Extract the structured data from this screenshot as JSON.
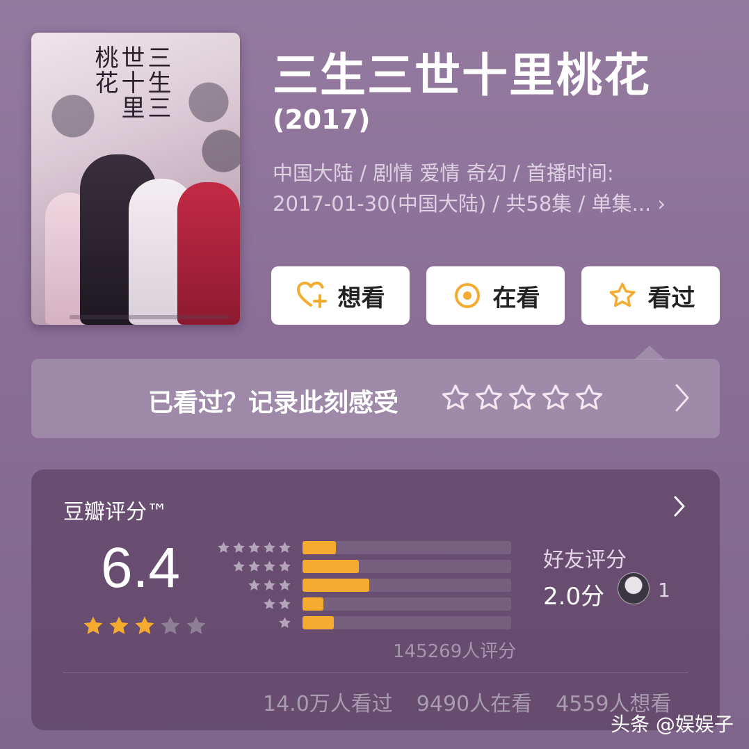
{
  "header": {
    "title": "三生三世十里桃花",
    "year": "(2017)",
    "meta_line1": "中国大陆 / 剧情 爱情 奇幻 / 首播时间:",
    "meta_line2": "2017-01-30(中国大陆) / 共58集 / 单集...",
    "meta_more": "›"
  },
  "poster": {
    "calligraphy": "三生三世十里桃花"
  },
  "actions": [
    {
      "label": "想看",
      "icon": "heart-plus-icon"
    },
    {
      "label": "在看",
      "icon": "target-circle-icon"
    },
    {
      "label": "看过",
      "icon": "star-outline-icon"
    }
  ],
  "record": {
    "prompt": "已看过？记录此刻感受",
    "stars": 0
  },
  "rating": {
    "label": "豆瓣评分™",
    "score": "6.4",
    "stars_filled": 3,
    "distribution": [
      {
        "stars": 5,
        "percent": 16
      },
      {
        "stars": 4,
        "percent": 27
      },
      {
        "stars": 3,
        "percent": 32
      },
      {
        "stars": 2,
        "percent": 10
      },
      {
        "stars": 1,
        "percent": 15
      }
    ],
    "count_text": "145269人评分",
    "friend_label": "好友评分",
    "friend_score": "2.0分",
    "friend_count": "1",
    "stats": [
      "14.0万人看过",
      "9490人在看",
      "4559人想看"
    ]
  },
  "colors": {
    "accent": "#f4ab2f",
    "background": "#8a6e96"
  },
  "watermark": "头条 @娱娱子"
}
